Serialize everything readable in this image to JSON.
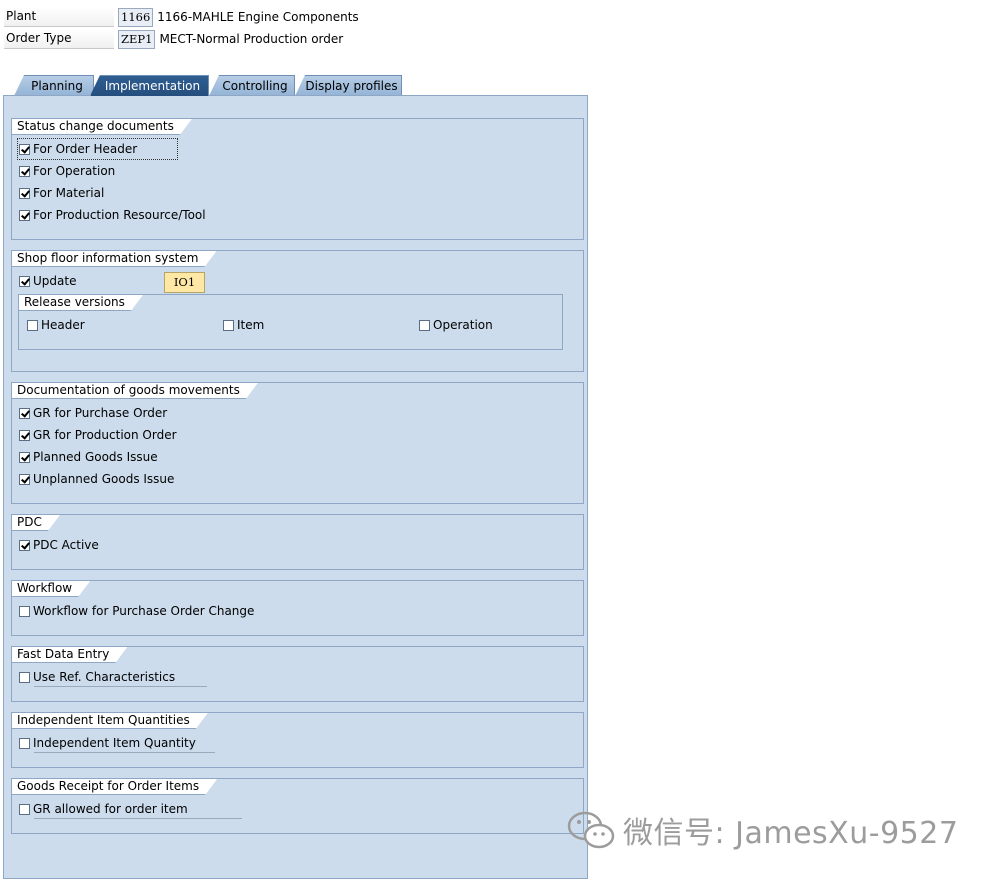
{
  "header": {
    "plant": {
      "label": "Plant",
      "code": "1166",
      "text": "1166-MAHLE Engine Components"
    },
    "order_type": {
      "label": "Order Type",
      "code": "ZEP1",
      "text": "MECT-Normal Production order"
    }
  },
  "tabs": [
    {
      "label": "Planning",
      "active": false
    },
    {
      "label": "Implementation",
      "active": true
    },
    {
      "label": "Controlling",
      "active": false
    },
    {
      "label": "Display profiles",
      "active": false
    }
  ],
  "groups": {
    "status": {
      "title": "Status change documents",
      "items": [
        {
          "label": "For Order Header",
          "checked": true
        },
        {
          "label": "For Operation",
          "checked": true
        },
        {
          "label": "For Material",
          "checked": true
        },
        {
          "label": "For Production Resource/Tool",
          "checked": true
        }
      ]
    },
    "shopfloor": {
      "title": "Shop floor information system",
      "update": {
        "label": "Update",
        "checked": true
      },
      "update_value": "IO1",
      "release": {
        "title": "Release versions",
        "items": [
          {
            "label": "Header",
            "checked": false
          },
          {
            "label": "Item",
            "checked": false
          },
          {
            "label": "Operation",
            "checked": false
          }
        ]
      }
    },
    "goods": {
      "title": "Documentation of goods movements",
      "items": [
        {
          "label": "GR for Purchase Order",
          "checked": true
        },
        {
          "label": "GR for Production Order",
          "checked": true
        },
        {
          "label": "Planned Goods Issue",
          "checked": true
        },
        {
          "label": "Unplanned Goods Issue",
          "checked": true
        }
      ]
    },
    "pdc": {
      "title": "PDC",
      "items": [
        {
          "label": "PDC Active",
          "checked": true
        }
      ]
    },
    "workflow": {
      "title": "Workflow",
      "items": [
        {
          "label": "Workflow for Purchase Order Change",
          "checked": false
        }
      ]
    },
    "fast": {
      "title": "Fast Data Entry",
      "items": [
        {
          "label": "Use Ref. Characteristics",
          "checked": false
        }
      ]
    },
    "indep": {
      "title": "Independent Item Quantities",
      "items": [
        {
          "label": "Independent Item Quantity",
          "checked": false
        }
      ]
    },
    "gr_items": {
      "title": "Goods Receipt for Order Items",
      "items": [
        {
          "label": "GR allowed for order item",
          "checked": false
        }
      ]
    }
  },
  "watermark": "微信号: JamesXu-9527",
  "icons": {
    "checkbox_checked": "check-mark-icon",
    "watermark_logo": "wechat-icon"
  },
  "colors": {
    "panel_bg": "#ccdcec",
    "active_tab": "#2f5e92",
    "field_highlight": "#ffe8a6"
  }
}
